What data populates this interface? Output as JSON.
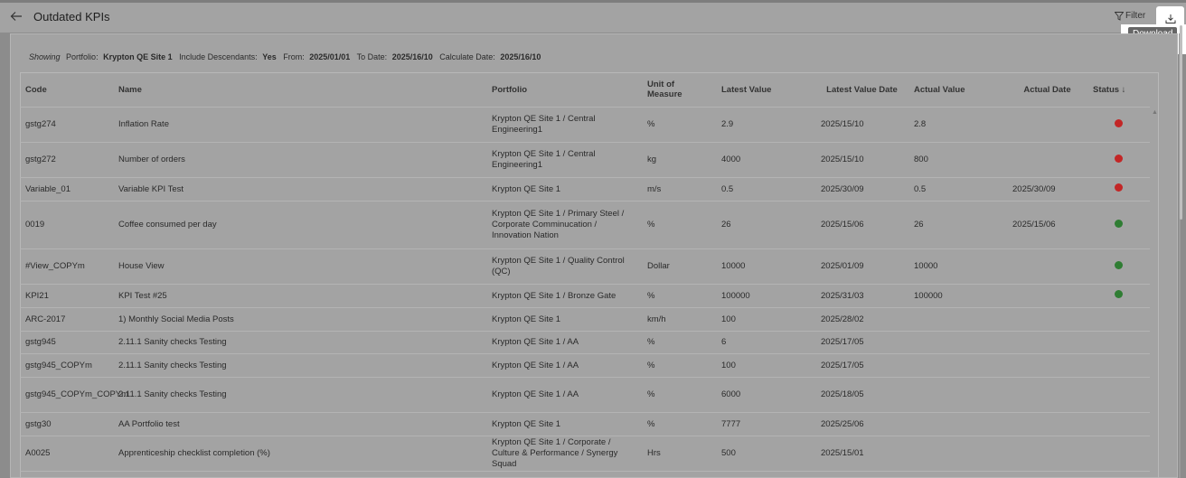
{
  "header": {
    "title": "Outdated KPIs",
    "filter_label": "Filter",
    "download_tooltip": "Download"
  },
  "showing": {
    "prefix": "Showing",
    "portfolio_label": "Portfolio:",
    "portfolio_value": "Krypton QE Site 1",
    "descendants_label": "Include Descendants:",
    "descendants_value": "Yes",
    "from_label": "From:",
    "from_value": "2025/01/01",
    "to_label": "To Date:",
    "to_value": "2025/16/10",
    "calc_label": "Calculate Date:",
    "calc_value": "2025/16/10"
  },
  "columns": [
    "Code",
    "Name",
    "Portfolio",
    "Unit of Measure",
    "Latest Value",
    "Latest Value Date",
    "Actual Value",
    "Actual Date",
    "Status ↓"
  ],
  "colors": {
    "red": "#c32626",
    "green": "#2f7d33"
  },
  "rows": [
    {
      "code": "gstg274",
      "name": "Inflation Rate",
      "portfolio": "Krypton QE Site 1 / Central Engineering1",
      "unit": "%",
      "latest": "2.9",
      "latest_date": "2025/15/10",
      "actual": "2.8",
      "actual_date": "",
      "status": "red"
    },
    {
      "code": "gstg272",
      "name": "Number of orders",
      "portfolio": "Krypton QE Site 1 / Central Engineering1",
      "unit": "kg",
      "latest": "4000",
      "latest_date": "2025/15/10",
      "actual": "800",
      "actual_date": "",
      "status": "red"
    },
    {
      "code": "Variable_01",
      "name": "Variable KPI Test",
      "portfolio": "Krypton QE Site 1",
      "unit": "m/s",
      "latest": "0.5",
      "latest_date": "2025/30/09",
      "actual": "0.5",
      "actual_date": "2025/30/09",
      "status": "red"
    },
    {
      "code": "0019",
      "name": "Coffee consumed per day",
      "portfolio": "Krypton QE Site 1 / Primary Steel / Corporate Comminucation / Innovation Nation",
      "unit": "%",
      "latest": "26",
      "latest_date": "2025/15/06",
      "actual": "26",
      "actual_date": "2025/15/06",
      "status": "green"
    },
    {
      "code": "#View_COPYm",
      "name": "House View",
      "portfolio": "Krypton QE Site 1 / Quality Control (QC)",
      "unit": "Dollar",
      "latest": "10000",
      "latest_date": "2025/01/09",
      "actual": "10000",
      "actual_date": "",
      "status": "green"
    },
    {
      "code": "KPI21",
      "name": "KPI Test #25",
      "portfolio": "Krypton QE Site 1 / Bronze Gate",
      "unit": "%",
      "latest": "100000",
      "latest_date": "2025/31/03",
      "actual": "100000",
      "actual_date": "",
      "status": "green"
    },
    {
      "code": "ARC-2017",
      "name": "1) Monthly Social Media Posts",
      "portfolio": "Krypton QE Site 1",
      "unit": "km/h",
      "latest": "100",
      "latest_date": "2025/28/02",
      "actual": "",
      "actual_date": "",
      "status": ""
    },
    {
      "code": "gstg945",
      "name": "2.11.1 Sanity checks Testing",
      "portfolio": "Krypton QE Site 1 / AA",
      "unit": "%",
      "latest": "6",
      "latest_date": "2025/17/05",
      "actual": "",
      "actual_date": "",
      "status": ""
    },
    {
      "code": "gstg945_COPYm",
      "name": "2.11.1 Sanity checks Testing",
      "portfolio": "Krypton QE Site 1 / AA",
      "unit": "%",
      "latest": "100",
      "latest_date": "2025/17/05",
      "actual": "",
      "actual_date": "",
      "status": ""
    },
    {
      "code": "gstg945_COPYm_COPYm",
      "name": "2.11.1 Sanity checks Testing",
      "portfolio": "Krypton QE Site 1 / AA",
      "unit": "%",
      "latest": "6000",
      "latest_date": "2025/18/05",
      "actual": "",
      "actual_date": "",
      "status": ""
    },
    {
      "code": "gstg30",
      "name": "AA Portfolio test",
      "portfolio": "Krypton QE Site 1",
      "unit": "%",
      "latest": "7777",
      "latest_date": "2025/25/06",
      "actual": "",
      "actual_date": "",
      "status": ""
    },
    {
      "code": "A0025",
      "name": "Apprenticeship checklist completion (%)",
      "portfolio": "Krypton QE Site 1 / Corporate / Culture & Performance / Synergy Squad",
      "unit": "Hrs",
      "latest": "500",
      "latest_date": "2025/15/01",
      "actual": "",
      "actual_date": "",
      "status": ""
    }
  ]
}
